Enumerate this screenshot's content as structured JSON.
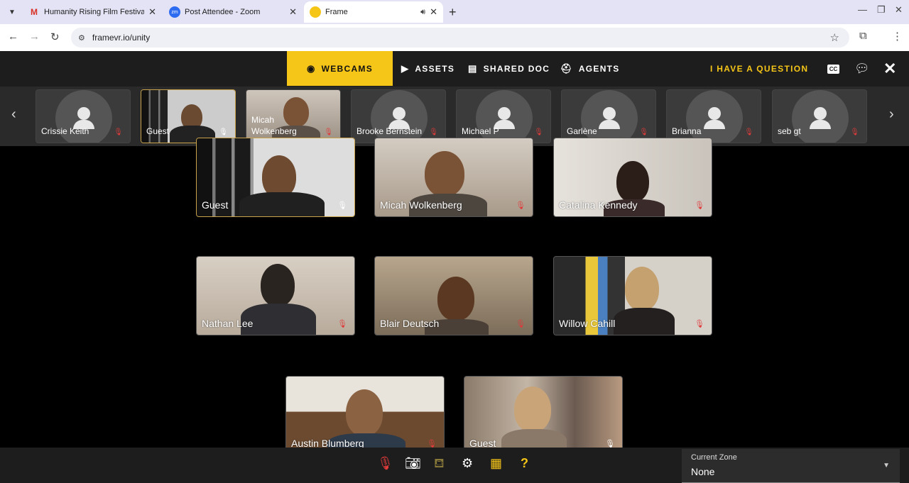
{
  "browser": {
    "tabs": [
      {
        "title": "Humanity Rising Film Festival",
        "favicon": "gmail-icon"
      },
      {
        "title": "Post Attendee - Zoom",
        "favicon": "zoom-icon"
      },
      {
        "title": "Frame",
        "favicon": "frame-icon"
      }
    ],
    "url": "framevr.io/unity"
  },
  "app": {
    "nav": [
      {
        "label": "WEBCAMS",
        "icon": "webcam-icon"
      },
      {
        "label": "ASSETS",
        "icon": "play-icon"
      },
      {
        "label": "SHARED DOC",
        "icon": "doc-icon"
      },
      {
        "label": "AGENTS",
        "icon": "robot-icon"
      }
    ],
    "question_label": "I HAVE A QUESTION",
    "cc_label": "CC",
    "accent_color": "#f5c518"
  },
  "strip": [
    {
      "name": "Crissie Keith",
      "muted": true
    },
    {
      "name": "Guest",
      "muted": false
    },
    {
      "name": "Micah Wolkenberg",
      "muted": true
    },
    {
      "name": "Brooke Bernstein",
      "muted": true
    },
    {
      "name": "Michael P",
      "muted": true
    },
    {
      "name": "Garlène",
      "muted": true
    },
    {
      "name": "Brianna",
      "muted": true
    },
    {
      "name": "seb gt",
      "muted": true
    }
  ],
  "grid": [
    {
      "name": "Guest",
      "muted": false
    },
    {
      "name": "Micah Wolkenberg",
      "muted": true
    },
    {
      "name": "Catalina Kennedy",
      "muted": true
    },
    {
      "name": "Nathan Lee",
      "muted": true
    },
    {
      "name": "Blair Deutsch",
      "muted": true
    },
    {
      "name": "Willow Cahill",
      "muted": true
    },
    {
      "name": "Austin Blumberg",
      "muted": true
    },
    {
      "name": "Guest",
      "muted": false
    }
  ],
  "bottom": {
    "zone_label": "Current Zone",
    "zone_value": "None"
  }
}
